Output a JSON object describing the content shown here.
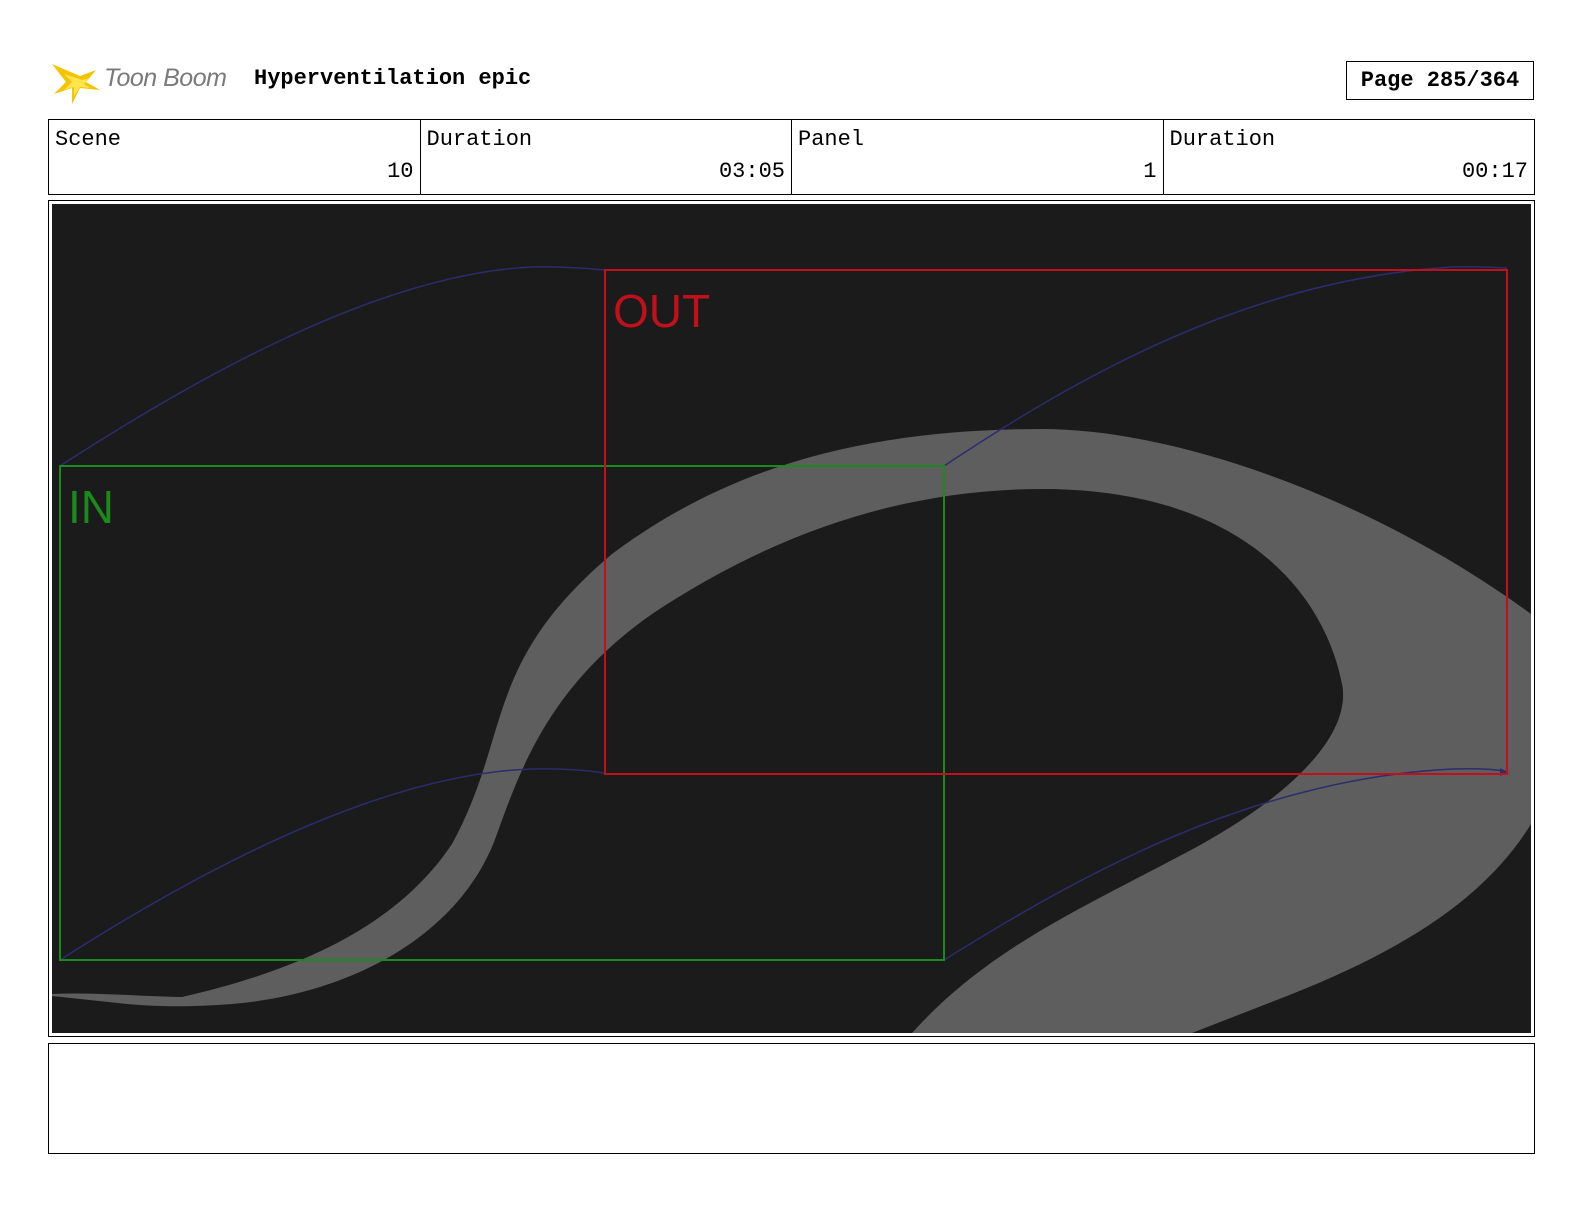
{
  "header": {
    "logo_text": "Toon Boom",
    "title": "Hyperventilation epic",
    "page": "Page 285/364"
  },
  "info": [
    {
      "label": "Scene",
      "value": "10"
    },
    {
      "label": "Duration",
      "value": "03:05"
    },
    {
      "label": "Panel",
      "value": "1"
    },
    {
      "label": "Duration",
      "value": "00:17"
    }
  ],
  "panel": {
    "in_label": "IN",
    "out_label": "OUT",
    "colors": {
      "background": "#1b1b1b",
      "stroke": "#5e5e5e",
      "in_frame": "#1a8a1a",
      "out_frame": "#c0101a",
      "motion_path": "#2c2c6e"
    }
  },
  "notes": {
    "text": ""
  }
}
